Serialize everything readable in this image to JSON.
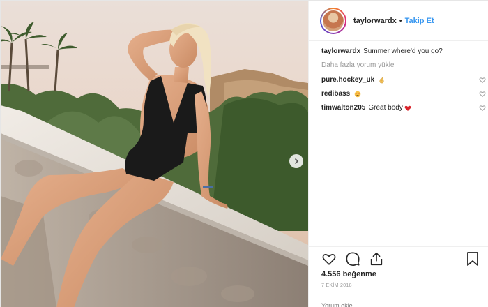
{
  "header": {
    "username": "taylorwardx",
    "separator": "•",
    "follow_label": "Takip Et"
  },
  "caption": {
    "username": "taylorwardx",
    "text": "Summer where'd you go?"
  },
  "load_more_label": "Daha fazla yorum yükle",
  "comments": [
    {
      "username": "pure.hockey_uk",
      "text": "",
      "emoji": "ok-hand-icon"
    },
    {
      "username": "redibass",
      "text": "",
      "emoji": "heart-eyes-icon"
    },
    {
      "username": "timwalton205",
      "text": "Great body",
      "emoji": "red-heart-icon"
    }
  ],
  "likes_label": "4.556 beğenme",
  "date_label": "7 EKİM 2018",
  "add_comment_placeholder": "Yorum ekle...",
  "colors": {
    "accent": "#3897f0",
    "text": "#262626",
    "muted": "#999999"
  }
}
